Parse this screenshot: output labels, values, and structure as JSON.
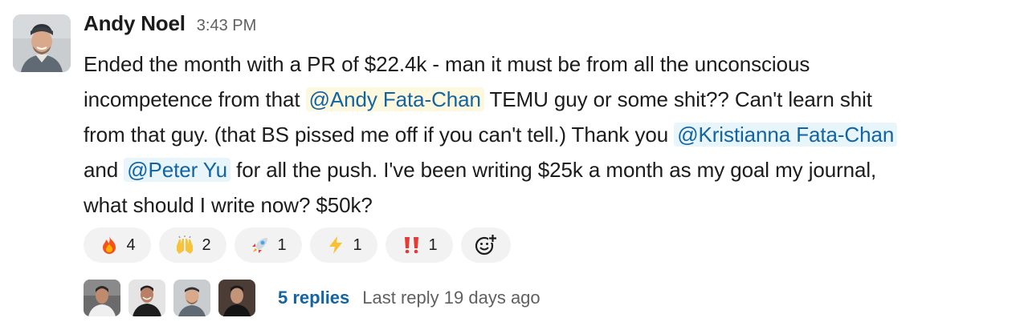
{
  "message": {
    "author": "Andy Noel",
    "timestamp": "3:43 PM",
    "text": {
      "line1": "Ended the month with a PR of $22.4k - man it must be from all the unconscious",
      "line2_pre": "incompetence from that ",
      "mention1": "@Andy Fata-Chan",
      "line2_post": " TEMU guy or some shit?? Can't learn shit",
      "line3_pre": "from that guy. (that BS pissed me off if you can't tell.) Thank you ",
      "mention2": "@Kristianna Fata-Chan",
      "line4_pre": "and ",
      "mention3": "@Peter Yu",
      "line4_post": " for all the push. I've been writing $25k a month as my goal my journal,",
      "line5": "what should I write now? $50k?"
    }
  },
  "reactions": [
    {
      "emoji": "fire-emoji",
      "count": "4"
    },
    {
      "emoji": "raised-hands-emoji",
      "count": "2"
    },
    {
      "emoji": "rocket-emoji",
      "count": "1"
    },
    {
      "emoji": "zap-emoji",
      "count": "1"
    },
    {
      "emoji": "double-exclamation-emoji",
      "count": "1"
    }
  ],
  "thread": {
    "replies_label": "5 replies",
    "last_reply": "Last reply 19 days ago"
  },
  "colors": {
    "link": "#1264a3",
    "mention_bg": "#e8f5fa",
    "self_mention_bg": "#fef9de",
    "reaction_bg": "#f2f2f2",
    "muted": "#616061"
  }
}
